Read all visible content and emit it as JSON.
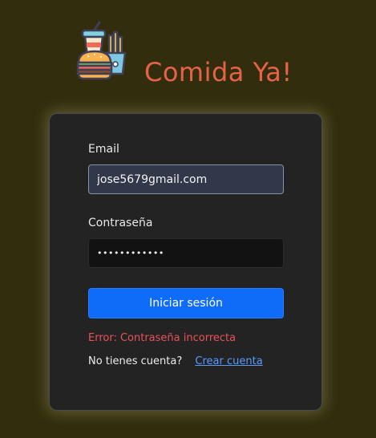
{
  "app": {
    "title": "Comida Ya!",
    "logo_icon": "fast-food-combo-icon"
  },
  "login_form": {
    "email_label": "Email",
    "email_value": "jose5679gmail.com",
    "password_label": "Contraseña",
    "password_value": "••••••••••••",
    "submit_label": "Iniciar sesión",
    "error_message": "Error: Contraseña incorrecta",
    "signup_prompt": "No tienes cuenta?",
    "signup_link": "Crear cuenta"
  },
  "colors": {
    "background": "#312d0d",
    "card": "#232323",
    "title": "#e8624a",
    "primary_button": "#0f6cf8",
    "error": "#e9525a",
    "link": "#5a9bff"
  }
}
